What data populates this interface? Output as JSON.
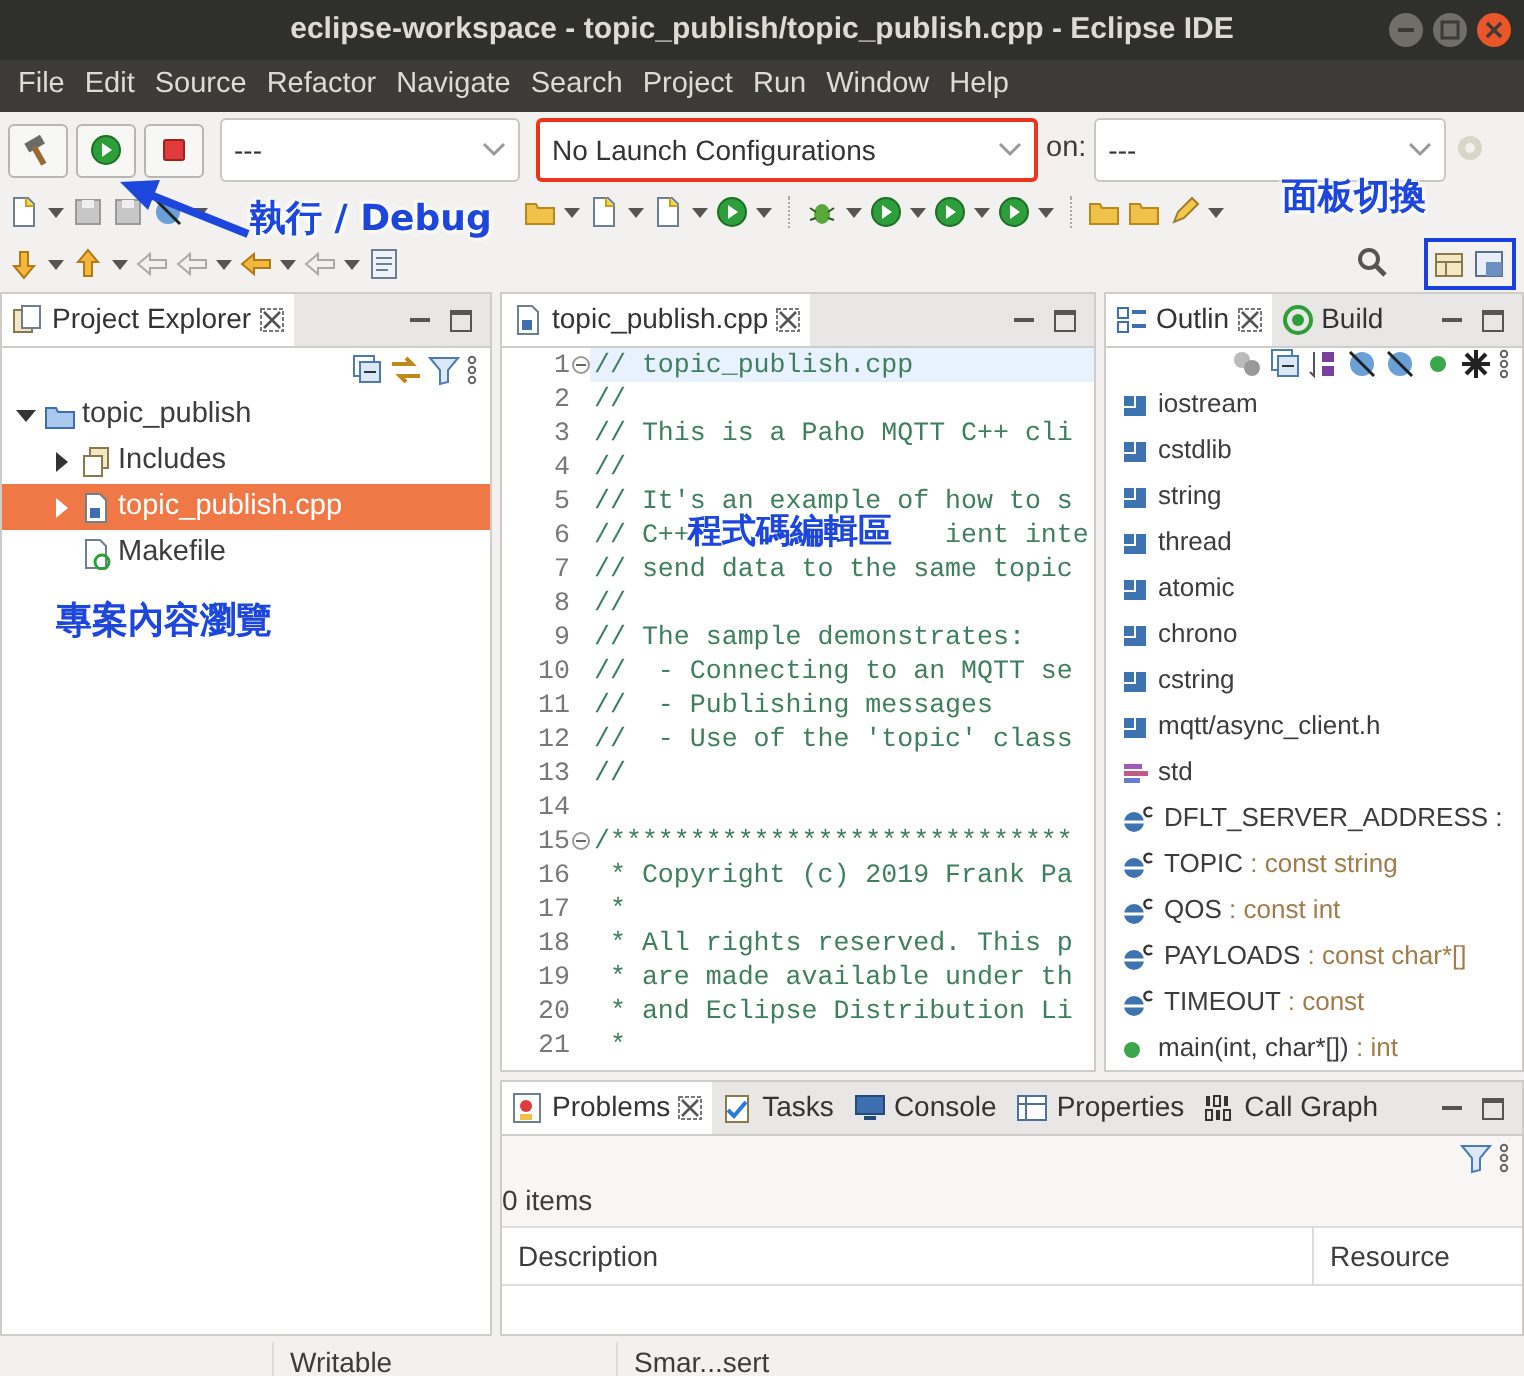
{
  "window": {
    "title": "eclipse-workspace - topic_publish/topic_publish.cpp - Eclipse IDE"
  },
  "menu": [
    "File",
    "Edit",
    "Source",
    "Refactor",
    "Navigate",
    "Search",
    "Project",
    "Run",
    "Window",
    "Help"
  ],
  "launch_bar": {
    "mode": "---",
    "configuration": {
      "value": "No Launch Configurations",
      "highlighted": true
    },
    "target_label": "on:",
    "target": "---"
  },
  "perspectives": {
    "highlighted": true
  },
  "annotations": [
    {
      "kind": "arrow",
      "text": "執行 / Debug"
    },
    {
      "kind": "label",
      "text": "面板切換"
    },
    {
      "kind": "label",
      "text": "專案內容瀏覽"
    },
    {
      "kind": "label",
      "text": "程式碼編輯區"
    }
  ],
  "project_explorer": {
    "title": "Project Explorer",
    "tree": [
      {
        "label": "topic_publish",
        "kind": "project",
        "expanded": true,
        "selected": false,
        "children": [
          {
            "label": "Includes",
            "kind": "includes",
            "expanded": false,
            "selected": false
          },
          {
            "label": "topic_publish.cpp",
            "kind": "source",
            "expanded": false,
            "selected": true
          },
          {
            "label": "Makefile",
            "kind": "makefile",
            "selected": false
          }
        ]
      }
    ]
  },
  "editor": {
    "tab": "topic_publish.cpp",
    "lines": [
      {
        "number": "1",
        "text": "// topic_publish.cpp",
        "foldable": true,
        "current": true
      },
      {
        "number": "2",
        "text": "//",
        "foldable": false,
        "current": false
      },
      {
        "number": "3",
        "text": "// This is a Paho MQTT C++ cli",
        "foldable": false,
        "current": false
      },
      {
        "number": "4",
        "text": "//",
        "foldable": false,
        "current": false
      },
      {
        "number": "5",
        "text": "// It's an example of how to s",
        "foldable": false,
        "current": false
      },
      {
        "number": "6",
        "text": "// C++",
        "tail": "ient inte",
        "foldable": false,
        "current": false
      },
      {
        "number": "7",
        "text": "// send data to the same topic",
        "foldable": false,
        "current": false
      },
      {
        "number": "8",
        "text": "//",
        "foldable": false,
        "current": false
      },
      {
        "number": "9",
        "text": "// The sample demonstrates:",
        "foldable": false,
        "current": false
      },
      {
        "number": "10",
        "text": "//  - Connecting to an MQTT se",
        "foldable": false,
        "current": false
      },
      {
        "number": "11",
        "text": "//  - Publishing messages",
        "foldable": false,
        "current": false
      },
      {
        "number": "12",
        "text": "//  - Use of the 'topic' class",
        "foldable": false,
        "current": false
      },
      {
        "number": "13",
        "text": "//",
        "foldable": false,
        "current": false
      },
      {
        "number": "14",
        "foldable": false,
        "current": false
      },
      {
        "number": "15",
        "text": "/*****************************",
        "foldable": true,
        "current": false
      },
      {
        "number": "16",
        "text": " * Copyright (c) 2019 Frank Pa",
        "foldable": false,
        "current": false
      },
      {
        "number": "17",
        "text": " *",
        "foldable": false,
        "current": false
      },
      {
        "number": "18",
        "text": " * All rights reserved. This p",
        "foldable": false,
        "current": false
      },
      {
        "number": "19",
        "text": " * are made available under th",
        "foldable": false,
        "current": false
      },
      {
        "number": "20",
        "text": " * and Eclipse Distribution Li",
        "foldable": false,
        "current": false
      },
      {
        "number": "21",
        "text": " *",
        "foldable": false,
        "current": false
      }
    ]
  },
  "outline": {
    "tabs": [
      {
        "label": "Outlin",
        "selected": true
      },
      {
        "label": "Build",
        "selected": false
      }
    ],
    "items": [
      {
        "kind": "include",
        "name": "iostream"
      },
      {
        "kind": "include",
        "name": "cstdlib"
      },
      {
        "kind": "include",
        "name": "string"
      },
      {
        "kind": "include",
        "name": "thread"
      },
      {
        "kind": "include",
        "name": "atomic"
      },
      {
        "kind": "include",
        "name": "chrono"
      },
      {
        "kind": "include",
        "name": "cstring"
      },
      {
        "kind": "include",
        "name": "mqtt/async_client.h"
      },
      {
        "kind": "namespace",
        "name": "std"
      },
      {
        "kind": "constant",
        "name": "DFLT_SERVER_ADDRESS :"
      },
      {
        "kind": "constant",
        "name": "TOPIC",
        "type": ": const string"
      },
      {
        "kind": "constant",
        "name": "QOS",
        "type": ": const int"
      },
      {
        "kind": "constant",
        "name": "PAYLOADS",
        "type": ": const char*[]"
      },
      {
        "kind": "constant",
        "name": "TIMEOUT",
        "type": ": const"
      },
      {
        "kind": "function",
        "name": "main(int, char*[])",
        "type": ": int"
      }
    ]
  },
  "bottom_panel": {
    "tabs": [
      {
        "label": "Problems",
        "selected": true
      },
      {
        "label": "Tasks",
        "selected": false
      },
      {
        "label": "Console",
        "selected": false
      },
      {
        "label": "Properties",
        "selected": false
      },
      {
        "label": "Call Graph",
        "selected": false
      }
    ],
    "summary": "0 items",
    "columns": [
      "Description",
      "Resource"
    ]
  },
  "status_bar": [
    "Writable",
    "Smar...sert"
  ]
}
